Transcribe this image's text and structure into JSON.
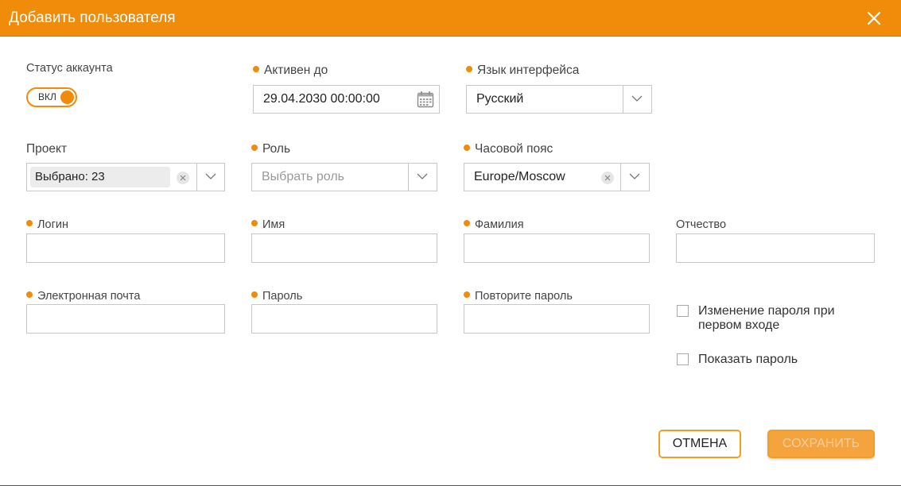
{
  "dialog": {
    "title": "Добавить пользователя",
    "close_icon": "close-icon"
  },
  "colors": {
    "accent": "#f08c0a",
    "border": "#c8c8c8"
  },
  "account_status": {
    "label": "Статус аккаунта",
    "toggle_text": "ВКЛ",
    "enabled": true
  },
  "active_until": {
    "label": "Активен до",
    "required": true,
    "value": "29.04.2030 00:00:00",
    "icon": "calendar-icon"
  },
  "ui_language": {
    "label": "Язык интерфейса",
    "required": true,
    "value": "Русский"
  },
  "project": {
    "label": "Проект",
    "required": false,
    "chip": "Выбрано: 23"
  },
  "role": {
    "label": "Роль",
    "required": true,
    "placeholder": "Выбрать роль"
  },
  "timezone": {
    "label": "Часовой пояс",
    "required": true,
    "value": "Europe/Moscow"
  },
  "login": {
    "label": "Логин",
    "required": true,
    "value": ""
  },
  "first_name": {
    "label": "Имя",
    "required": true,
    "value": ""
  },
  "last_name": {
    "label": "Фамилия",
    "required": true,
    "value": ""
  },
  "middle_name": {
    "label": "Отчество",
    "required": false,
    "value": ""
  },
  "email": {
    "label": "Электронная почта",
    "required": true,
    "value": ""
  },
  "password": {
    "label": "Пароль",
    "required": true,
    "value": ""
  },
  "password_repeat": {
    "label": "Повторите пароль",
    "required": true,
    "value": ""
  },
  "checkboxes": {
    "change_password_line1": "Изменение пароля при",
    "change_password_line2": "первом входе",
    "change_password_checked": false,
    "show_password": "Показать пароль",
    "show_password_checked": false
  },
  "buttons": {
    "cancel": "ОТМЕНА",
    "save": "СОХРАНИТЬ"
  }
}
